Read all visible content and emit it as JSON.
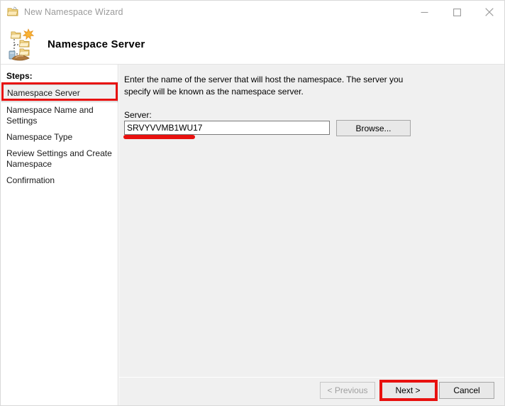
{
  "window": {
    "title": "New Namespace Wizard",
    "title_icon": "namespace-folder-icon",
    "controls": {
      "minimize": "minimize-icon",
      "maximize": "maximize-icon",
      "close": "close-icon"
    }
  },
  "header": {
    "icon": "dfs-namespace-icon",
    "title": "Namespace Server"
  },
  "sidebar": {
    "heading": "Steps:",
    "items": [
      {
        "label": "Namespace Server",
        "current": true
      },
      {
        "label": "Namespace Name and Settings",
        "current": false
      },
      {
        "label": "Namespace Type",
        "current": false
      },
      {
        "label": "Review Settings and Create Namespace",
        "current": false
      },
      {
        "label": "Confirmation",
        "current": false
      }
    ]
  },
  "main": {
    "description": "Enter the name of the server that will host the namespace. The server you specify will be known as the namespace server.",
    "server_label": "Server:",
    "server_value": "SRVYVVMB1WU17",
    "server_placeholder": "",
    "browse_label": "Browse..."
  },
  "footer": {
    "previous_label": "< Previous",
    "next_label": "Next >",
    "cancel_label": "Cancel"
  },
  "annotations": {
    "accent_color": "#e8110f",
    "highlight_step": "Namespace Server",
    "highlight_button": "Next >",
    "underline_target": "Server:"
  }
}
